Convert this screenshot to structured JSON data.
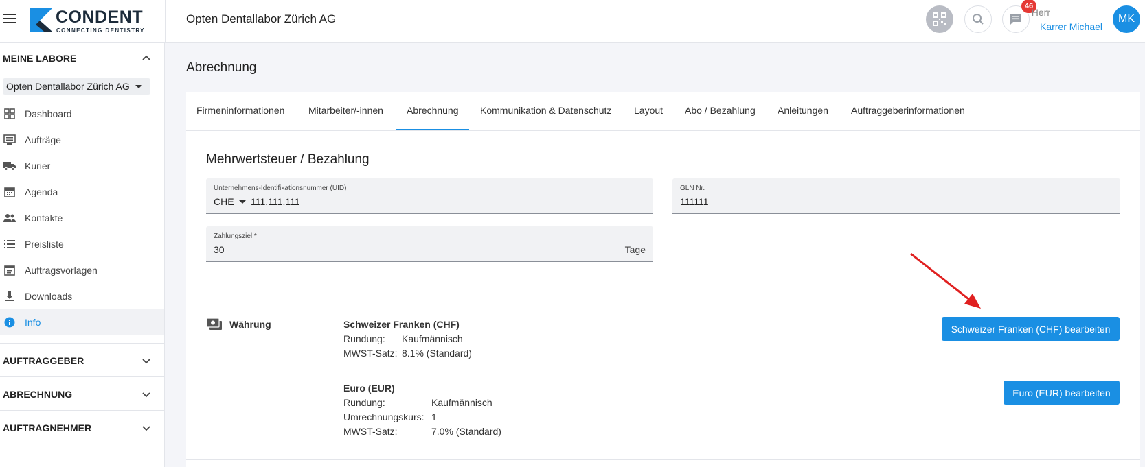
{
  "header": {
    "logo_text": "CONDENT",
    "logo_subtext": "CONNECTING DENTISTRY",
    "company": "Opten Dentallabor Zürich AG",
    "notification_count": "46",
    "user_salutation": "Herr",
    "user_name": "Karrer Michael",
    "user_initials": "MK"
  },
  "sidebar": {
    "section_labs": "MEINE LABORE",
    "lab_selected": "Opten Dentallabor Zürich AG",
    "items": [
      {
        "label": "Dashboard",
        "icon": "dashboard-icon"
      },
      {
        "label": "Aufträge",
        "icon": "orders-icon"
      },
      {
        "label": "Kurier",
        "icon": "truck-icon"
      },
      {
        "label": "Agenda",
        "icon": "calendar-icon"
      },
      {
        "label": "Kontakte",
        "icon": "people-icon"
      },
      {
        "label": "Preisliste",
        "icon": "list-icon"
      },
      {
        "label": "Auftragsvorlagen",
        "icon": "template-icon"
      },
      {
        "label": "Downloads",
        "icon": "download-icon"
      },
      {
        "label": "Info",
        "icon": "info-icon"
      }
    ],
    "section_clients": "AUFTRAGGEBER",
    "section_billing": "ABRECHNUNG",
    "section_contractors": "AUFTRAGNEHMER"
  },
  "main": {
    "page_title": "Abrechnung",
    "tabs": [
      {
        "label": "Firmeninformationen"
      },
      {
        "label": "Mitarbeiter/-innen"
      },
      {
        "label": "Abrechnung"
      },
      {
        "label": "Kommunikation & Datenschutz"
      },
      {
        "label": "Layout"
      },
      {
        "label": "Abo / Bezahlung"
      },
      {
        "label": "Anleitungen"
      },
      {
        "label": "Auftraggeberinformationen"
      }
    ],
    "active_tab": "Abrechnung",
    "section_title": "Mehrwertsteuer / Bezahlung",
    "uid": {
      "label": "Unternehmens-Identifikationsnummer (UID)",
      "prefix": "CHE",
      "value": "111.111.111"
    },
    "gln": {
      "label": "GLN Nr.",
      "value": "111111"
    },
    "payment": {
      "label": "Zahlungsziel *",
      "value": "30",
      "suffix": "Tage"
    },
    "currency_label": "Währung",
    "chf": {
      "name": "Schweizer Franken (CHF)",
      "rounding_label": "Rundung:",
      "rounding": "Kaufmännisch",
      "vat_label": "MWST-Satz:",
      "vat": "8.1% (Standard)",
      "button": "Schweizer Franken (CHF) bearbeiten"
    },
    "eur": {
      "name": "Euro (EUR)",
      "rounding_label": "Rundung:",
      "rounding": "Kaufmännisch",
      "rate_label": "Umrechnungskurs:",
      "rate": "1",
      "vat_label": "MWST-Satz:",
      "vat": "7.0% (Standard)",
      "button": "Euro (EUR) bearbeiten"
    }
  },
  "colors": {
    "accent": "#1a8fe3",
    "badge": "#e53935",
    "annotation_arrow": "#e02020"
  }
}
